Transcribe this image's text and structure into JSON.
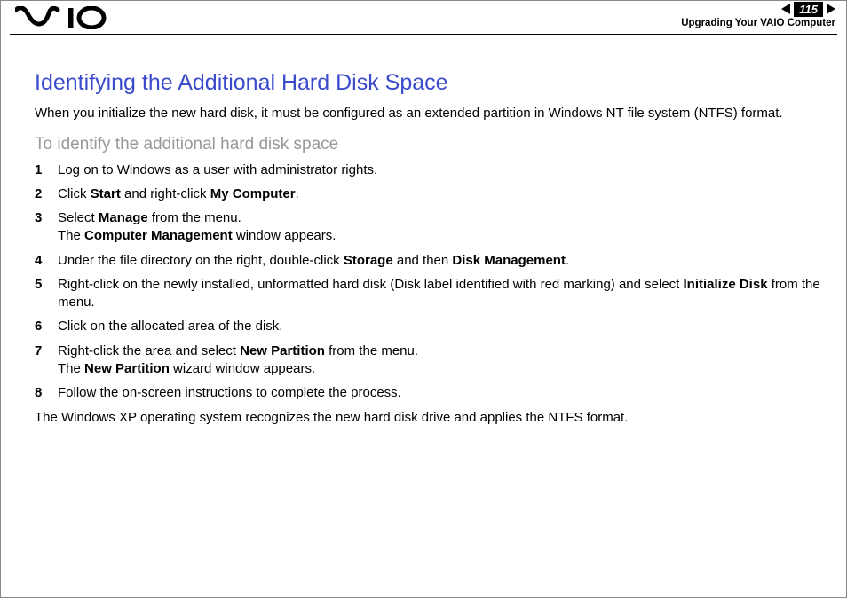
{
  "header": {
    "page_number": "115",
    "breadcrumb": "Upgrading Your VAIO Computer"
  },
  "content": {
    "title": "Identifying the Additional Hard Disk Space",
    "intro": "When you initialize the new hard disk, it must be configured as an extended partition in Windows NT file system (NTFS) format.",
    "subtitle": "To identify the additional hard disk space",
    "steps": [
      {
        "n": "1",
        "parts": [
          {
            "t": "Log on to Windows as a user with administrator rights.",
            "b": false
          }
        ]
      },
      {
        "n": "2",
        "parts": [
          {
            "t": "Click ",
            "b": false
          },
          {
            "t": "Start",
            "b": true
          },
          {
            "t": " and right-click ",
            "b": false
          },
          {
            "t": "My Computer",
            "b": true
          },
          {
            "t": ".",
            "b": false
          }
        ]
      },
      {
        "n": "3",
        "parts": [
          {
            "t": "Select ",
            "b": false
          },
          {
            "t": "Manage",
            "b": true
          },
          {
            "t": " from the menu.",
            "b": false
          },
          {
            "t": "\n",
            "b": false
          },
          {
            "t": "The ",
            "b": false
          },
          {
            "t": "Computer Management",
            "b": true
          },
          {
            "t": " window appears.",
            "b": false
          }
        ]
      },
      {
        "n": "4",
        "parts": [
          {
            "t": "Under the file directory on the right, double-click ",
            "b": false
          },
          {
            "t": "Storage",
            "b": true
          },
          {
            "t": " and then ",
            "b": false
          },
          {
            "t": "Disk Management",
            "b": true
          },
          {
            "t": ".",
            "b": false
          }
        ]
      },
      {
        "n": "5",
        "parts": [
          {
            "t": "Right-click on the newly installed, unformatted hard disk (Disk label identified with red marking) and select ",
            "b": false
          },
          {
            "t": "Initialize Disk",
            "b": true
          },
          {
            "t": " from the menu.",
            "b": false
          }
        ]
      },
      {
        "n": "6",
        "parts": [
          {
            "t": "Click on the allocated area of the disk.",
            "b": false
          }
        ]
      },
      {
        "n": "7",
        "parts": [
          {
            "t": "Right-click the area and select ",
            "b": false
          },
          {
            "t": "New Partition",
            "b": true
          },
          {
            "t": " from the menu.",
            "b": false
          },
          {
            "t": "\n",
            "b": false
          },
          {
            "t": "The ",
            "b": false
          },
          {
            "t": "New Partition",
            "b": true
          },
          {
            "t": " wizard window appears.",
            "b": false
          }
        ]
      },
      {
        "n": "8",
        "parts": [
          {
            "t": "Follow the on-screen instructions to complete the process.",
            "b": false
          }
        ]
      }
    ],
    "closing": "The Windows XP operating system recognizes the new hard disk drive and applies the NTFS format."
  }
}
